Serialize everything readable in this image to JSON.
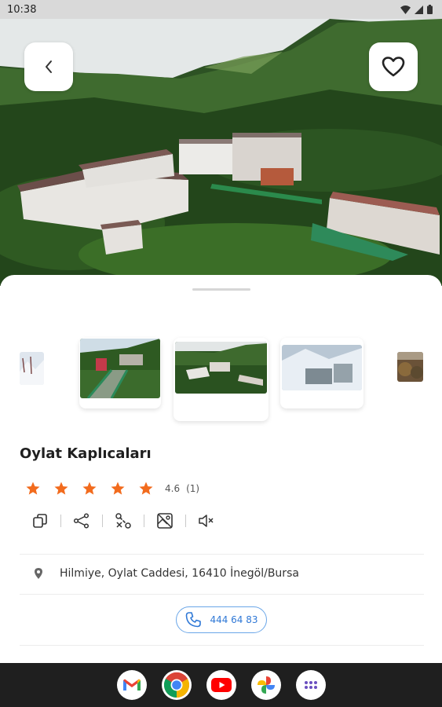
{
  "status_bar": {
    "time": "10:38"
  },
  "hero": {
    "icons": {
      "back": "chevron-left-icon",
      "favorite": "heart-outline-icon"
    }
  },
  "place": {
    "name": "Oylat Kaplıcaları",
    "rating": {
      "value": "4.6",
      "count": "(1)",
      "stars": 5
    },
    "address": "Hilmiye, Oylat Caddesi, 16410 İnegöl/Bursa",
    "phone": "444 64 83"
  },
  "actions": [
    {
      "icon": "copy-icon"
    },
    {
      "icon": "share-icon"
    },
    {
      "icon": "route-icon"
    },
    {
      "icon": "map-icon"
    },
    {
      "icon": "volume-mute-icon"
    }
  ],
  "gallery": {
    "items": [
      {
        "icon": "snow-landscape-thumbnail"
      },
      {
        "icon": "walkway-bridge-thumbnail"
      },
      {
        "icon": "hotel-aerial-thumbnail"
      },
      {
        "icon": "snowy-hotel-thumbnail"
      },
      {
        "icon": "autumn-forest-thumbnail"
      }
    ]
  },
  "colors": {
    "star": "#f26b1d",
    "accent": "#2f78d6",
    "phone_border": "#6aa6e8"
  },
  "navbar": {
    "apps": [
      "gmail-icon",
      "chrome-icon",
      "youtube-icon",
      "photos-icon",
      "app-drawer-icon"
    ]
  }
}
